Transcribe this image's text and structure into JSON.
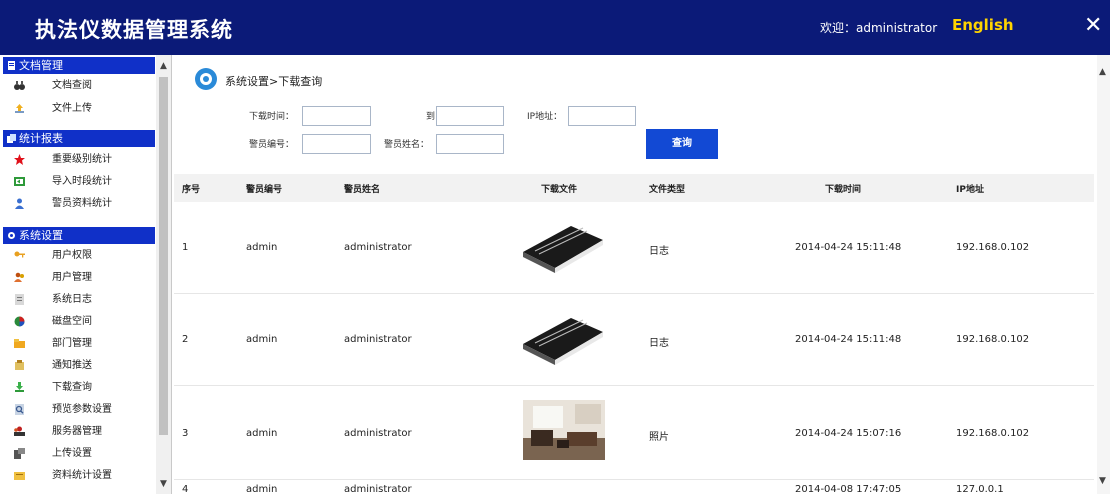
{
  "header": {
    "title": "执法仪数据管理系统",
    "welcome": "欢迎：administrator",
    "language": "English",
    "close": "✕"
  },
  "sidebar": {
    "sections": [
      {
        "label": "文档管理",
        "items": [
          {
            "label": "文档查阅",
            "icon": "binoculars-icon"
          },
          {
            "label": "文件上传",
            "icon": "upload-icon"
          }
        ]
      },
      {
        "label": "统计报表",
        "items": [
          {
            "label": "重要级别统计",
            "icon": "star-icon"
          },
          {
            "label": "导入时段统计",
            "icon": "import-icon"
          },
          {
            "label": "警员资料统计",
            "icon": "user-icon"
          }
        ]
      },
      {
        "label": "系统设置",
        "items": [
          {
            "label": "用户权限",
            "icon": "key-icon"
          },
          {
            "label": "用户管理",
            "icon": "users-icon"
          },
          {
            "label": "系统日志",
            "icon": "log-icon"
          },
          {
            "label": "磁盘空间",
            "icon": "disk-icon"
          },
          {
            "label": "部门管理",
            "icon": "department-icon"
          },
          {
            "label": "通知推送",
            "icon": "notify-icon"
          },
          {
            "label": "下载查询",
            "icon": "download-icon"
          },
          {
            "label": "预览参数设置",
            "icon": "preview-settings-icon"
          },
          {
            "label": "服务器管理",
            "icon": "server-icon"
          },
          {
            "label": "上传设置",
            "icon": "upload-settings-icon"
          },
          {
            "label": "资料统计设置",
            "icon": "stats-settings-icon"
          }
        ]
      }
    ]
  },
  "main": {
    "breadcrumb": "系统设置>下载查询",
    "filters": {
      "download_time_label": "下载时间：",
      "to_label": "到",
      "ip_label": "IP地址：",
      "officer_id_label": "警员编号：",
      "officer_name_label": "警员姓名：",
      "download_time_from": "",
      "download_time_to": "",
      "ip_value": "",
      "officer_id_value": "",
      "officer_name_value": ""
    },
    "query_button": "查询",
    "table": {
      "columns": [
        "序号",
        "警员编号",
        "警员姓名",
        "下载文件",
        "文件类型",
        "下载时间",
        "IP地址"
      ],
      "rows": [
        {
          "no": "1",
          "officer_id": "admin",
          "officer_name": "administrator",
          "file": "book-thumbnail",
          "type": "日志",
          "time": "2014-04-24 15:11:48",
          "ip": "192.168.0.102"
        },
        {
          "no": "2",
          "officer_id": "admin",
          "officer_name": "administrator",
          "file": "book-thumbnail",
          "type": "日志",
          "time": "2014-04-24 15:11:48",
          "ip": "192.168.0.102"
        },
        {
          "no": "3",
          "officer_id": "admin",
          "officer_name": "administrator",
          "file": "photo-thumbnail",
          "type": "照片",
          "time": "2014-04-24 15:07:16",
          "ip": "192.168.0.102"
        },
        {
          "no": "4",
          "officer_id": "admin",
          "officer_name": "administrator",
          "file": "",
          "type": "",
          "time": "2014-04-08 17:47:05",
          "ip": "127.0.0.1"
        }
      ]
    }
  },
  "colors": {
    "header_bg": "#0b1a78",
    "accent": "#1249d4",
    "language_link": "#ffd400",
    "section_head": "#1030c8"
  }
}
